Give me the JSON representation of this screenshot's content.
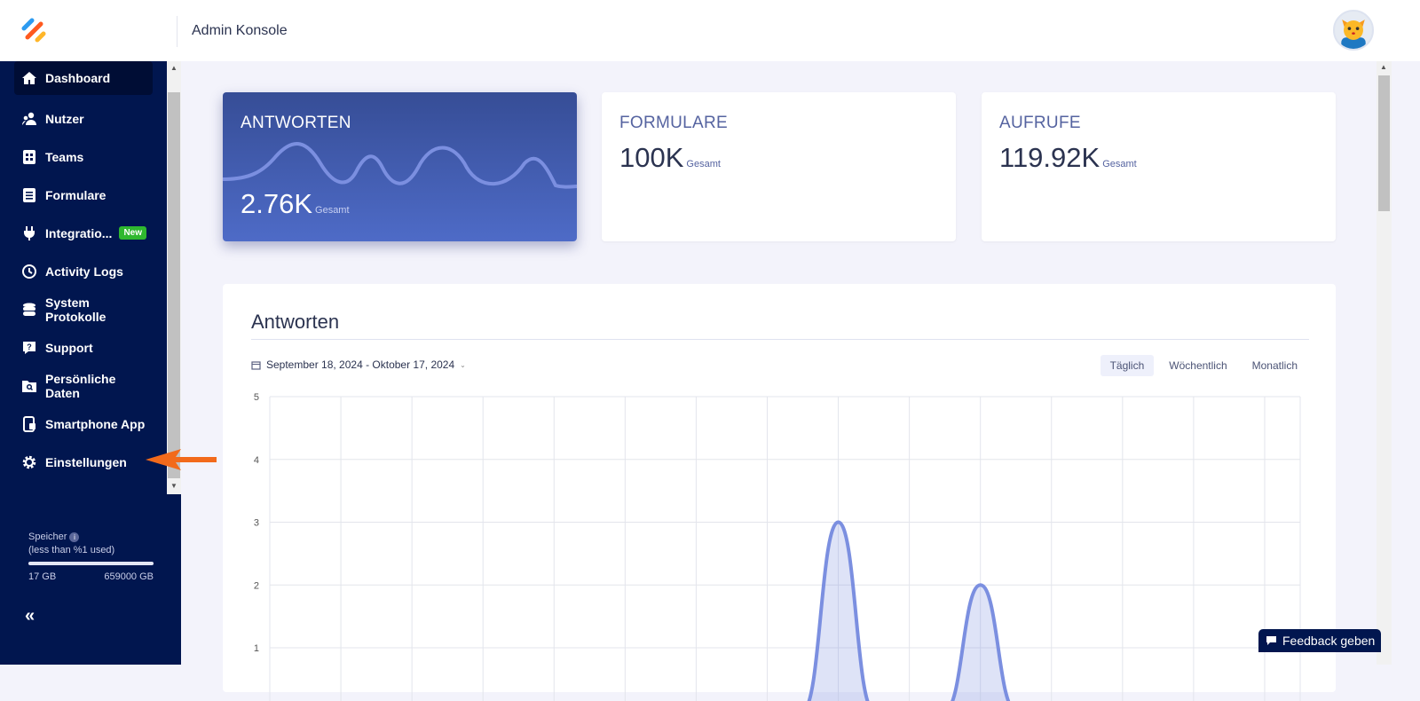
{
  "header": {
    "title": "Admin Konsole"
  },
  "sidebar": {
    "items": [
      {
        "label": "Dashboard",
        "icon": "home-icon"
      },
      {
        "label": "Nutzer",
        "icon": "users-icon"
      },
      {
        "label": "Teams",
        "icon": "teams-icon"
      },
      {
        "label": "Formulare",
        "icon": "form-icon"
      },
      {
        "label": "Integratio...",
        "icon": "plug-icon",
        "badge": "New"
      },
      {
        "label": "Activity Logs",
        "icon": "clock-icon"
      },
      {
        "label": "System Protokolle",
        "icon": "database-icon"
      },
      {
        "label": "Support",
        "icon": "support-icon"
      },
      {
        "label": "Persönliche Daten",
        "icon": "folder-search-icon"
      },
      {
        "label": "Smartphone App",
        "icon": "phone-icon"
      },
      {
        "label": "Einstellungen",
        "icon": "gear-icon"
      }
    ],
    "storage": {
      "label": "Speicher",
      "usage": "(less than %1 used)",
      "used": "17 GB",
      "total": "659000 GB",
      "fraction": 0.0
    }
  },
  "cards": [
    {
      "title": "ANTWORTEN",
      "value": "2.76K",
      "suffix": "Gesamt"
    },
    {
      "title": "FORMULARE",
      "value": "100K",
      "suffix": "Gesamt"
    },
    {
      "title": "AUFRUFE",
      "value": "119.92K",
      "suffix": "Gesamt"
    }
  ],
  "chart_section": {
    "title": "Antworten",
    "date_range": "September 18, 2024 - Oktober 17, 2024",
    "tabs": [
      "Täglich",
      "Wöchentlich",
      "Monatlich"
    ],
    "active_tab": "Täglich"
  },
  "chart_data": {
    "type": "area",
    "title": "Antworten",
    "ylim": [
      0,
      5
    ],
    "yticks": [
      1,
      2,
      3,
      4,
      5
    ],
    "x_days": 30,
    "values": [
      0,
      0,
      0,
      0,
      0,
      0,
      0,
      0,
      0,
      0,
      0,
      0,
      0,
      0,
      0,
      0,
      3,
      0,
      0,
      0,
      2,
      0,
      0,
      0,
      0,
      0,
      0,
      0,
      0,
      0
    ],
    "color": "#7b8fe0"
  },
  "feedback": {
    "label": "Feedback geben"
  },
  "colors": {
    "sidebar": "#01164f",
    "accent": "#4e6bc7"
  }
}
